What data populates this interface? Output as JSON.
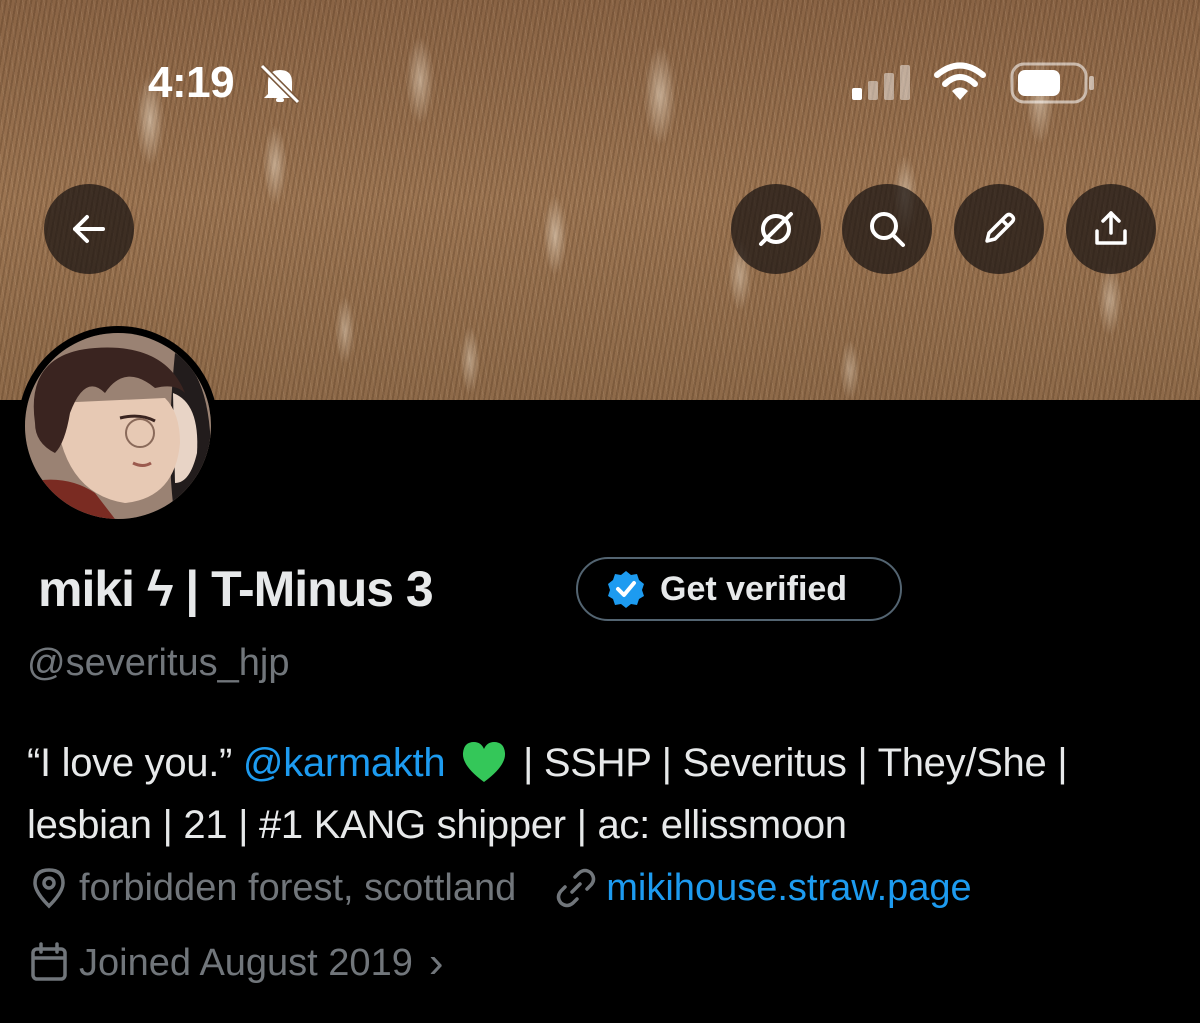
{
  "status_bar": {
    "time": "4:19"
  },
  "profile": {
    "display_name": "miki ϟ | T-Minus 3",
    "handle": "@severitus_hjp",
    "verify_label": "Get verified",
    "bio": {
      "quote": "“I love you.” ",
      "mention": "@karmakth",
      "line1_rest": " | SSHP | Severitus | They/She |",
      "line2": "lesbian | 21 | #1 KANG shipper | ac: ellissmoon"
    },
    "location": "forbidden forest, scottland",
    "website": "mikihouse.straw.page",
    "joined": "Joined August 2019",
    "joined_chevron": "›"
  },
  "colors": {
    "background": "#000000",
    "accent": "#1d9bf0",
    "muted": "#71767b",
    "text": "#e7e9ea"
  },
  "icons": {
    "back": "arrow-left-icon",
    "grok": "grok-icon",
    "search": "search-icon",
    "edit": "pencil-icon",
    "share": "share-icon",
    "verified": "verified-badge-icon",
    "location": "location-pin-icon",
    "link": "link-icon",
    "calendar": "calendar-icon",
    "heart": "green-heart-emoji"
  }
}
